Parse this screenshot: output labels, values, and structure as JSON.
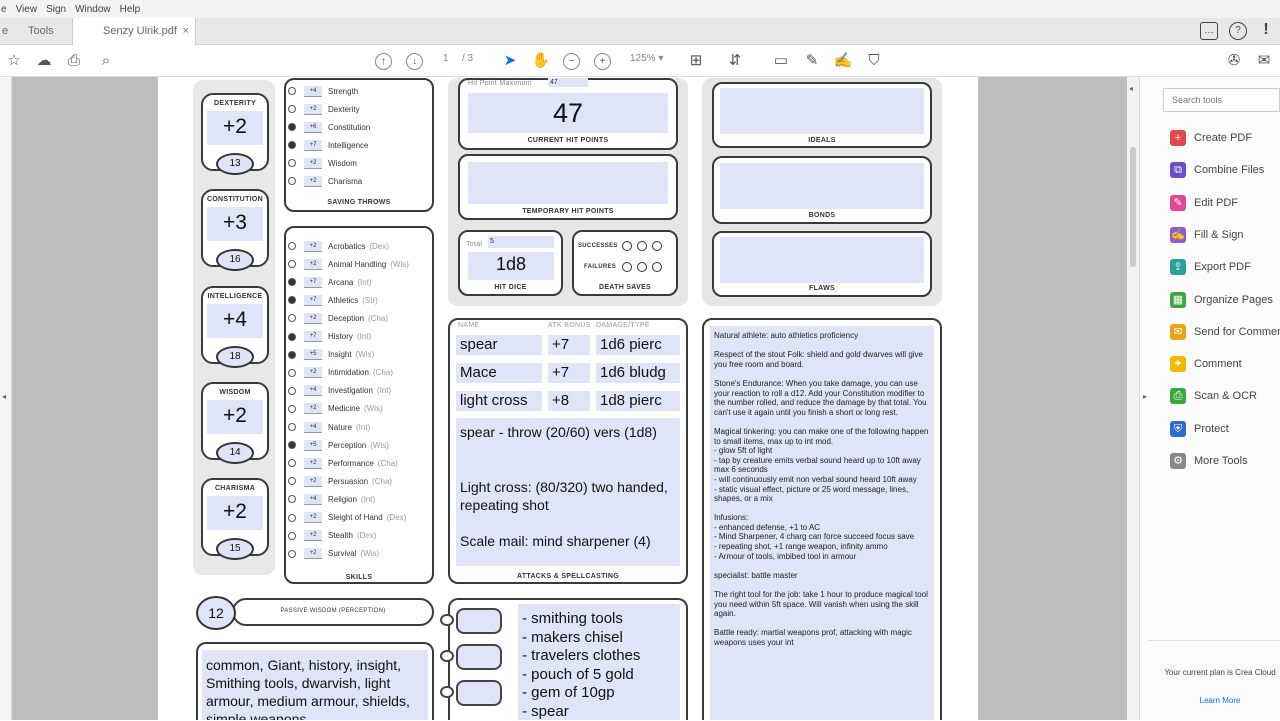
{
  "menubar": {
    "items": [
      "e",
      "View",
      "Sign",
      "Window",
      "Help"
    ]
  },
  "tabs": {
    "home": "e",
    "tools": "Tools",
    "doc": "Senzy Ulrik.pdf",
    "close": "×"
  },
  "toolbar": {
    "page_current": "1",
    "page_total": "/ 3",
    "zoom": "125%"
  },
  "sheet": {
    "abilities": [
      {
        "name": "DEXTERITY",
        "mod": "+2",
        "score": "13"
      },
      {
        "name": "CONSTITUTION",
        "mod": "+3",
        "score": "16"
      },
      {
        "name": "INTELLIGENCE",
        "mod": "+4",
        "score": "18"
      },
      {
        "name": "WISDOM",
        "mod": "+2",
        "score": "14"
      },
      {
        "name": "CHARISMA",
        "mod": "+2",
        "score": "15"
      }
    ],
    "saves": [
      {
        "val": "+4",
        "name": "Strength",
        "prof": false
      },
      {
        "val": "+2",
        "name": "Dexterity",
        "prof": false
      },
      {
        "val": "+6",
        "name": "Constitution",
        "prof": true
      },
      {
        "val": "+7",
        "name": "Intelligence",
        "prof": true
      },
      {
        "val": "+2",
        "name": "Wisdom",
        "prof": false
      },
      {
        "val": "+2",
        "name": "Charisma",
        "prof": false
      }
    ],
    "saves_label": "SAVING THROWS",
    "skills": [
      {
        "val": "+2",
        "name": "Acrobatics",
        "ab": "(Dex)",
        "prof": false
      },
      {
        "val": "+2",
        "name": "Animal Handling",
        "ab": "(Wis)",
        "prof": false
      },
      {
        "val": "+7",
        "name": "Arcana",
        "ab": "(Int)",
        "prof": true
      },
      {
        "val": "+7",
        "name": "Athletics",
        "ab": "(Str)",
        "prof": true
      },
      {
        "val": "+2",
        "name": "Deception",
        "ab": "(Cha)",
        "prof": false
      },
      {
        "val": "+7",
        "name": "History",
        "ab": "(Int)",
        "prof": true
      },
      {
        "val": "+5",
        "name": "Insight",
        "ab": "(Wis)",
        "prof": true
      },
      {
        "val": "+2",
        "name": "Intimidation",
        "ab": "(Cha)",
        "prof": false
      },
      {
        "val": "+4",
        "name": "Investigation",
        "ab": "(Int)",
        "prof": false
      },
      {
        "val": "+2",
        "name": "Medicine",
        "ab": "(Wis)",
        "prof": false
      },
      {
        "val": "+4",
        "name": "Nature",
        "ab": "(Int)",
        "prof": false
      },
      {
        "val": "+5",
        "name": "Perception",
        "ab": "(Wis)",
        "prof": true
      },
      {
        "val": "+2",
        "name": "Performance",
        "ab": "(Cha)",
        "prof": false
      },
      {
        "val": "+2",
        "name": "Persuasion",
        "ab": "(Cha)",
        "prof": false
      },
      {
        "val": "+4",
        "name": "Religion",
        "ab": "(Int)",
        "prof": false
      },
      {
        "val": "+2",
        "name": "Sleight of Hand",
        "ab": "(Dex)",
        "prof": false
      },
      {
        "val": "+2",
        "name": "Stealth",
        "ab": "(Dex)",
        "prof": false
      },
      {
        "val": "+2",
        "name": "Survival",
        "ab": "(Wis)",
        "prof": false
      }
    ],
    "skills_label": "SKILLS",
    "hp_max_label": "Hit Point Maximum",
    "hp_max": "47",
    "hp_current": "47",
    "hp_current_label": "CURRENT HIT POINTS",
    "hp_temp_label": "TEMPORARY HIT POINTS",
    "hd_total_label": "Total",
    "hd_total": "5",
    "hd": "1d8",
    "hd_label": "HIT DICE",
    "ds_success": "SUCCESSES",
    "ds_fail": "FAILURES",
    "ds_label": "DEATH SAVES",
    "ideals": "IDEALS",
    "bonds": "BONDS",
    "flaws": "FLAWS",
    "atk_hdr_name": "NAME",
    "atk_hdr_bonus": "ATK BONUS",
    "atk_hdr_dmg": "DAMAGE/TYPE",
    "attacks": [
      {
        "name": "spear",
        "bonus": "+7",
        "dmg": "1d6 pierc"
      },
      {
        "name": "Mace",
        "bonus": "+7",
        "dmg": "1d6 bludg"
      },
      {
        "name": "light cross",
        "bonus": "+8",
        "dmg": "1d8 pierc"
      }
    ],
    "atk_notes": [
      "spear - throw (20/60) vers (1d8)",
      "Light cross: (80/320) two handed, repeating shot",
      "Scale mail: mind sharpener (4)"
    ],
    "atk_label": "ATTACKS & SPELLCASTING",
    "passive_val": "12",
    "passive_label": "PASSIVE WISDOM (PERCEPTION)",
    "profs": "common, Giant, history, insight, Smithing tools, dwarvish, light armour, medium armour, shields, simple weapons",
    "equipment": [
      "- smithing tools",
      "- makers chisel",
      "- travelers clothes",
      "- pouch of 5 gold",
      "- gem of 10gp",
      "- spear"
    ],
    "features": "Natural athlete: auto athletics proficiency\n\nRespect of the stout Folk: shield and gold dwarves will give you free room and board.\n\nStone's Endurance: When you take damage, you can use your reaction to roll a d12. Add your Constitution modifier to the number rolled, and reduce the damage by that total. You can't use it again until you finish a short or long rest.\n\nMagical tinkering: you can make one of the following happen to small items, max up to int mod.\n- glow 5ft of light\n- tap by creature emits verbal sound heard up to 10ft away max 6 seconds\n- will continuously emit non verbal sound heard 10ft away\n- static visual effect, picture or 25 word message, lines, shapes, or a mix\n\nInfusions:\n- enhanced defense, +1 to AC\n- Mind Sharpener, 4 charg can force succeed focus save\n- repeating shot, +1 range weapon, infinity ammo\n- Armour of tools, imbibed tool in armour\n\nspecialist: battle master\n\nThe right tool for the job: take 1 hour to produce magical tool you need within 5ft space. Will vanish when using the skill again.\n\nBattle ready: martial weapons prof, attacking with magic weapons uses your int"
  },
  "panel": {
    "search_placeholder": "Search tools",
    "items": [
      {
        "label": "Create PDF",
        "color": "#e34850",
        "glyph": "+"
      },
      {
        "label": "Combine Files",
        "color": "#6d4fc9",
        "glyph": "⧉"
      },
      {
        "label": "Edit PDF",
        "color": "#e34896",
        "glyph": "✎"
      },
      {
        "label": "Fill & Sign",
        "color": "#8b5cd6",
        "glyph": "✍"
      },
      {
        "label": "Export PDF",
        "color": "#2aa198",
        "glyph": "⇪"
      },
      {
        "label": "Organize Pages",
        "color": "#3fa63f",
        "glyph": "▦"
      },
      {
        "label": "Send for Commen",
        "color": "#e8a317",
        "glyph": "✉"
      },
      {
        "label": "Comment",
        "color": "#f5b800",
        "glyph": "✦"
      },
      {
        "label": "Scan & OCR",
        "color": "#3fa63f",
        "glyph": "⎙"
      },
      {
        "label": "Protect",
        "color": "#2d6bcf",
        "glyph": "⛨"
      },
      {
        "label": "More Tools",
        "color": "#888888",
        "glyph": "⚙"
      }
    ],
    "plan": "Your current plan is Crea Cloud",
    "learn": "Learn More"
  }
}
